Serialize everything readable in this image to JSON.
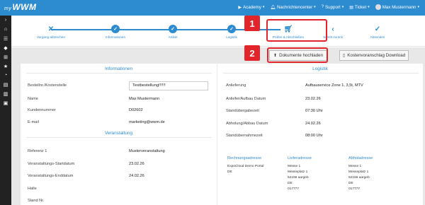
{
  "header": {
    "logo_prefix": "my",
    "logo": "WWM",
    "nav": [
      {
        "label": "Academy",
        "icon": "video-camera-icon"
      },
      {
        "label": "Nachrichtencenter",
        "icon": "bell-icon"
      },
      {
        "label": "Support",
        "icon": "question-circle-icon"
      },
      {
        "label": "Ticket",
        "icon": "ticket-icon"
      },
      {
        "label": "Max Mustermann",
        "icon": "avatar"
      }
    ]
  },
  "sidebar": {
    "icons": [
      "chevron-right-icon",
      "home-icon",
      "list-icon",
      "tags-icon",
      "sitemap-icon",
      "star-icon",
      "dashboard-icon",
      "list-alt-icon",
      "building-icon",
      "suitcase-icon"
    ]
  },
  "wizard": {
    "steps": [
      {
        "label": "Vorgang abbrechen",
        "icon": "close-icon"
      },
      {
        "label": "Informationen",
        "icon": "check-circle-icon"
      },
      {
        "label": "Artikel",
        "icon": "check-circle-icon"
      },
      {
        "label": "Logistik",
        "icon": "check-circle-icon"
      },
      {
        "label": "Prüfen & Abschließen",
        "icon": "shopping-cart-icon"
      },
      {
        "label": "Schritt zurück",
        "icon": "chevron-left-icon"
      },
      {
        "label": "Absenden",
        "icon": "check-icon"
      }
    ]
  },
  "actions": {
    "upload_label": "Dokumente hochladen",
    "quote_label": "Kostenvoranschlag Download"
  },
  "annotations": {
    "badge1": "1",
    "badge2": "2"
  },
  "informationen": {
    "title": "Informationen",
    "rows": [
      {
        "label": "Bestellnr./Kostenstelle",
        "value": "Testbestellung!!!!!!"
      },
      {
        "label": "Name",
        "value": "Max Mustermann"
      },
      {
        "label": "Kundennummer",
        "value": "D02602"
      },
      {
        "label": "E-mail",
        "value": "marketing@wwm.de"
      }
    ]
  },
  "veranstaltung": {
    "title": "Veranstaltung",
    "rows": [
      {
        "label": "Referenz 1",
        "value": "Musterveranstaltung"
      },
      {
        "label": "Veranstaltungs-Startdatum",
        "value": "23.02.26"
      },
      {
        "label": "Veranstaltungs-Enddatum",
        "value": "24.02.26"
      },
      {
        "label": "Halle",
        "value": ""
      },
      {
        "label": "Stand Nr.",
        "value": ""
      }
    ]
  },
  "logistik": {
    "title": "Logistik",
    "rows": [
      {
        "label": "Anlieferung",
        "value": "Aufbauservice Zone 1, 3,5t, MTV"
      },
      {
        "label": "Anliefer/Aufbau Datum",
        "value": "23.02.26"
      },
      {
        "label": "Standübergabezeit",
        "value": "07:30 Uhr"
      },
      {
        "label": "Abholung/Abbau Datum",
        "value": "24.02.26"
      },
      {
        "label": "Standübernahmezeit",
        "value": "08:00 Uhr"
      }
    ]
  },
  "addresses": {
    "rechnung": {
      "title": "Rechnungsadresse",
      "lines": [
        "ExpoCloud Demo Portal",
        "DE"
      ]
    },
    "liefer": {
      "title": "Lieferadresse",
      "lines": [
        "Messe 1",
        "Messeplatz 1",
        "52156 aargeb",
        "DE",
        "017777"
      ]
    },
    "abhol": {
      "title": "Abholadresse",
      "lines": [
        "Messe 1",
        "Messeplatz 1",
        "52156 aargeb",
        "DE",
        "017777"
      ]
    }
  },
  "colors": {
    "accent": "#2d8bd0",
    "highlight": "#e2252b",
    "sidebar": "#222222"
  }
}
